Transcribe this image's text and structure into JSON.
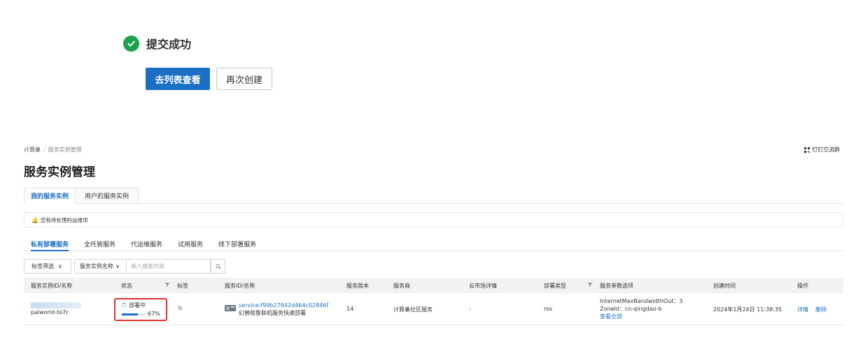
{
  "success": {
    "title": "提交成功",
    "go_list_button": "去列表查看",
    "create_again_button": "再次创建"
  },
  "breadcrumb": [
    "计算巢",
    "服务实例管理"
  ],
  "top_right_link": "钉钉交流群",
  "page_title": "服务实例管理",
  "tabs": [
    "我的服务实例",
    "用户的服务实例"
  ],
  "notice": "您有待处理的运维项",
  "subtabs": [
    "私有部署服务",
    "全托管服务",
    "代运维服务",
    "试用服务",
    "线下部署服务"
  ],
  "filters": {
    "tag_filter": "标签筛选",
    "field_select": "服务实例名称",
    "search_placeholder": "输入搜索内容"
  },
  "table": {
    "headers": [
      "服务实例ID/名称",
      "状态",
      "标签",
      "服务ID/名称",
      "服务版本",
      "服务商",
      "云市场详情",
      "部署类型",
      "服务参数选项",
      "创建时间",
      "操作"
    ],
    "rows": [
      {
        "instance_id": "si-d3be745ecf004",
        "instance_name": "palworld-to7r",
        "status": "部署中",
        "progress_label": "67%",
        "progress": 0.67,
        "service_id": "service-f99b27842d464c02846f",
        "service_name": "幻兽帕鲁联机服务快速部署",
        "version": "14",
        "provider": "计算巢社区服务",
        "market": "-",
        "deploy_type": "ros",
        "params_line1": "InternetMaxBandwidthOut：3",
        "params_line2": "ZoneId：cn-qingdao-b",
        "params_more": "查看全部",
        "created": "2024年1月24日 11:38:35",
        "action_detail": "详情",
        "action_delete": "删除"
      }
    ]
  },
  "colors": {
    "primary": "#1b6fc4",
    "success": "#1ba24b",
    "highlight": "#e0332c"
  }
}
